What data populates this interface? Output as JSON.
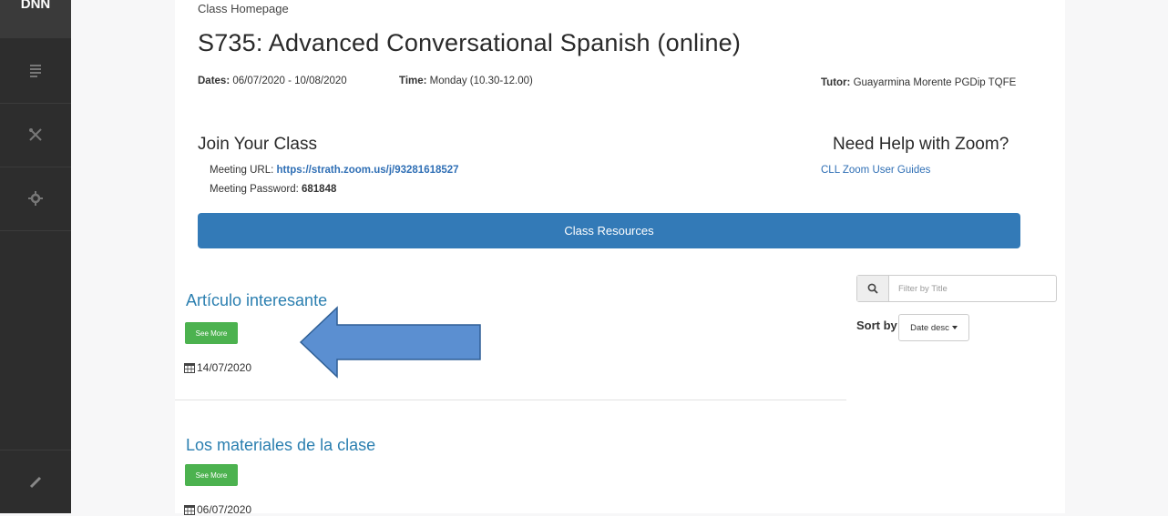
{
  "sidebar": {
    "logo_text": "DNN",
    "icons": [
      "pages-icon",
      "tools-icon",
      "settings-icon",
      "edit-icon"
    ]
  },
  "breadcrumb": "Class Homepage",
  "course": {
    "title": "S735: Advanced Conversational Spanish (online)",
    "dates_label": "Dates:",
    "dates_value": "06/07/2020 - 10/08/2020",
    "time_label": "Time:",
    "time_value": "Monday (10.30-12.00)",
    "tutor_label": "Tutor:",
    "tutor_value": "Guayarmina Morente PGDip TQFE"
  },
  "join": {
    "heading": "Join Your Class",
    "url_label": "Meeting URL:",
    "url_value": "https://strath.zoom.us/j/93281618527",
    "password_label": "Meeting Password:",
    "password_value": "681848"
  },
  "help": {
    "heading": "Need Help with Zoom?",
    "guide_link": "CLL Zoom User Guides"
  },
  "resources_button": "Class Resources",
  "filter": {
    "placeholder": "Filter by Title"
  },
  "sort": {
    "label": "Sort by",
    "selected": "Date desc"
  },
  "items": [
    {
      "title": "Artículo interesante",
      "button": "See More",
      "date": "14/07/2020"
    },
    {
      "title": "Los materiales de la clase",
      "button": "See More",
      "date": "06/07/2020"
    }
  ],
  "colors": {
    "sidebar": "#2d2d2d",
    "primary_button": "#337ab7",
    "see_more": "#4cb24f",
    "link": "#2b7fb0",
    "arrow_fill": "#5b8fd1",
    "arrow_stroke": "#2f5f95"
  }
}
